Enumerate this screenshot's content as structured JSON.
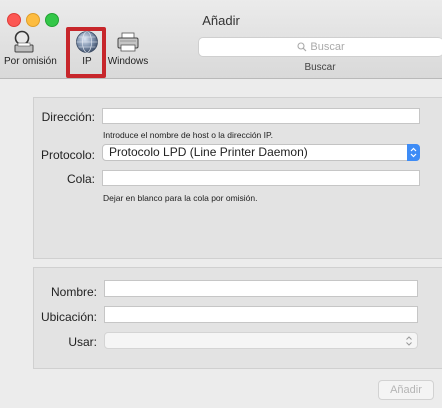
{
  "window": {
    "title": "Añadir"
  },
  "toolbar": {
    "items": [
      {
        "label": "Por omisión",
        "icon": "default-printer-icon"
      },
      {
        "label": "IP",
        "icon": "globe-icon",
        "selected": true
      },
      {
        "label": "Windows",
        "icon": "windows-printer-icon"
      }
    ],
    "search": {
      "placeholder": "Buscar",
      "caption": "Buscar"
    }
  },
  "form": {
    "address": {
      "label": "Dirección:",
      "value": "",
      "hint": "Introduce el nombre de host o la dirección IP."
    },
    "protocol": {
      "label": "Protocolo:",
      "value": "Protocolo LPD (Line Printer Daemon)"
    },
    "queue": {
      "label": "Cola:",
      "value": "",
      "hint": "Dejar en blanco para la cola por omisión."
    }
  },
  "details": {
    "name": {
      "label": "Nombre:",
      "value": ""
    },
    "location": {
      "label": "Ubicación:",
      "value": ""
    },
    "use": {
      "label": "Usar:",
      "value": ""
    }
  },
  "buttons": {
    "add": "Añadir"
  },
  "colors": {
    "highlight": "#c7262b",
    "accent": "#3e8cf6"
  }
}
